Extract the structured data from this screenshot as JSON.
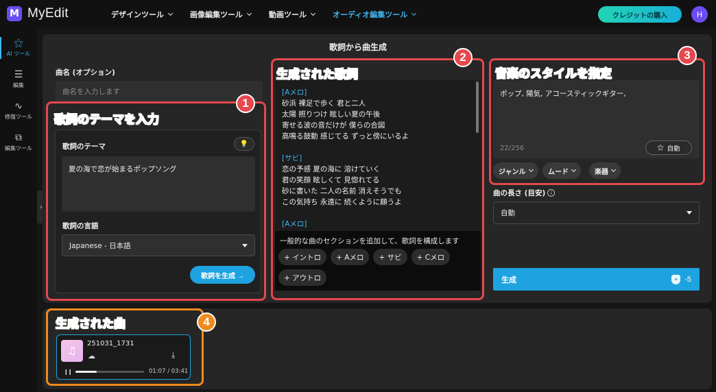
{
  "header": {
    "logo_mark": "M",
    "app_name": "MyEdit",
    "nav": [
      "デザインツール",
      "画像編集ツール",
      "動画ツール",
      "オーディオ編集ツール"
    ],
    "credit_button": "クレジットの購入",
    "avatar_initial": "H"
  },
  "sidebar": {
    "items": [
      {
        "label": "AI ツール",
        "icon": "magic-wand-icon"
      },
      {
        "label": "編集",
        "icon": "sliders-icon"
      },
      {
        "label": "修復ツール",
        "icon": "waveform-icon"
      },
      {
        "label": "編集ツール",
        "icon": "layers-icon"
      }
    ]
  },
  "page_title": "歌詞から曲生成",
  "song_name": {
    "label": "曲名 (オプション)",
    "placeholder": "曲名を入力します"
  },
  "theme": {
    "card_label": "歌詞のテーマ",
    "value": "夏の海で恋が始まるポップソング",
    "language_label": "歌詞の言語",
    "language_value": "Japanese - 日本語",
    "generate_button": "歌詞を生成 →"
  },
  "lyrics": {
    "sections": [
      {
        "head": "[Aメロ]",
        "lines": [
          "砂浜 裸足で歩く 君と二人",
          "太陽 照りつけ 眩しい夏の午後",
          "寄せる波の音だけが 僕らの合図",
          "高鳴る鼓動 感じてる ずっと傍にいるよ"
        ]
      },
      {
        "head": "[サビ]",
        "lines": [
          "恋の予感 夏の海に 溶けていく",
          "君の笑顔 眩しくて 見惚れてる",
          "砂に書いた 二人の名前 消えそうでも",
          "この気持ち 永遠に 続くように願うよ"
        ]
      },
      {
        "head": "[Aメロ]",
        "lines": []
      }
    ],
    "section_hint": "一般的な曲のセクションを追加して、歌詞を構成します",
    "chips": [
      "+ イントロ",
      "+ Aメロ",
      "+ サビ",
      "+ Cメロ",
      "+ アウトロ"
    ]
  },
  "style": {
    "value": "ポップ, 陽気, アコースティックギター,",
    "count": "22/256",
    "auto_button": "自動",
    "pills": [
      "ジャンル",
      "ムード",
      "楽器"
    ],
    "length_label": "曲の長さ (目安)",
    "length_value": "自動",
    "generate_button": "生成",
    "cost": "-5"
  },
  "result": {
    "song_name": "251031_1731",
    "time": "01:07 / 03:41",
    "progress": 0.31
  },
  "annotations": {
    "n1": {
      "num": "1",
      "title": "歌詞のテーマを入力"
    },
    "n2": {
      "num": "2",
      "title": "生成された歌詞"
    },
    "n3": {
      "num": "3",
      "title": "音楽のスタイルを指定"
    },
    "n4": {
      "num": "4",
      "title": "生成された曲"
    }
  },
  "colors": {
    "accent": "#1ea3e0",
    "annotation_red": "#e5484d",
    "annotation_orange": "#f08a1c",
    "logo": "#6c4df2"
  }
}
